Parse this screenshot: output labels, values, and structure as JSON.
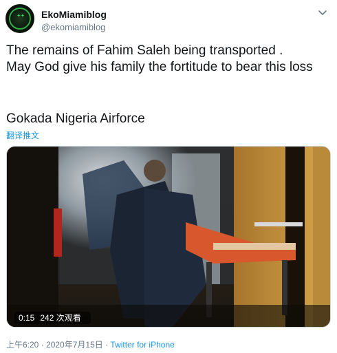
{
  "author": {
    "display_name": "EkoMiamiblog",
    "handle": "@ekomiamiblog",
    "avatar_icon": "brand-logo-avatar"
  },
  "tweet": {
    "text_main": "The remains of Fahim Saleh being transported .\nMay God give his family the fortitude to bear this loss",
    "text_tag": "Gokada Nigeria Airforce",
    "translate_label": "翻译推文"
  },
  "media": {
    "duration": "0:15",
    "views": "242 次观看"
  },
  "footer": {
    "time": "上午6:20",
    "separator_1": " · ",
    "date": "2020年7月15日",
    "separator_2": " · ",
    "source": "Twitter for iPhone"
  },
  "colors": {
    "link": "#1b95e0",
    "secondary_text": "#657786",
    "primary_text": "#14171a"
  }
}
